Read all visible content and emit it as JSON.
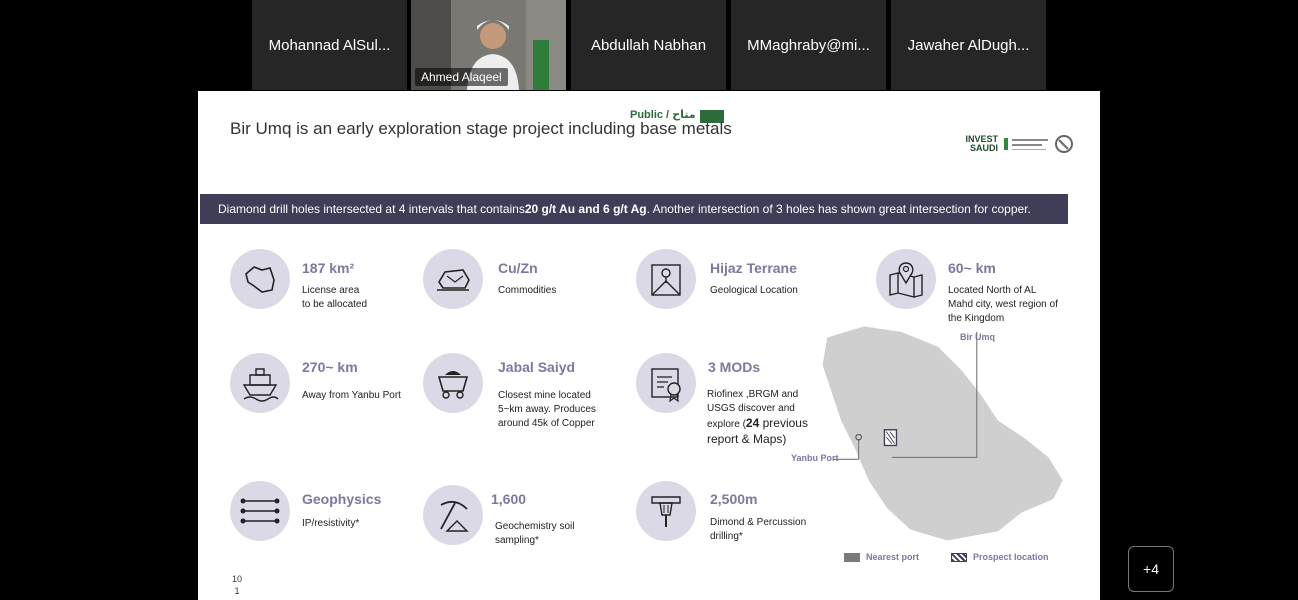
{
  "participants": [
    {
      "name": "Mohannad AlSul..."
    },
    {
      "name": "Ahmed Alaqeel"
    },
    {
      "name": "Abdullah Nabhan"
    },
    {
      "name": "MMaghraby@mi..."
    },
    {
      "name": "Jawaher AlDugh..."
    }
  ],
  "more_participants": "+4",
  "slide": {
    "classification": "Public / متاح",
    "title": "Bir Umq is an early exploration stage project including base metals",
    "logo_text_line1": "INVEST",
    "logo_text_line2": "SAUDI",
    "banner": {
      "pre": "Diamond drill holes intersected at 4 intervals that contains ",
      "bold": "20 g/t Au and 6 g/t Ag",
      "post": ". Another intersection of 3 holes has shown great intersection for copper."
    },
    "items": [
      {
        "icon": "saudi-map-icon",
        "head": "187 km²",
        "desc": "License area\nto be allocated"
      },
      {
        "icon": "ore-rock-icon",
        "head": "Cu/Zn",
        "desc": "Commodities"
      },
      {
        "icon": "map-pin-paper-icon",
        "head": "Hijaz Terrane",
        "desc": "Geological Location"
      },
      {
        "icon": "location-map-icon",
        "head": "60~ km",
        "desc": "Located North of AL Mahd city, west region of the Kingdom"
      },
      {
        "icon": "ship-icon",
        "head": "270~ km",
        "desc": "Away from Yanbu Port"
      },
      {
        "icon": "mine-cart-icon",
        "head": "Jabal Saiyd",
        "desc": "Closest mine located 5~km away. Produces around 45k of Copper"
      },
      {
        "icon": "certificate-icon",
        "head": "3 MODs",
        "desc_pre": "Riofinex ,BRGM and USGS discover and explore (",
        "desc_bold": "24",
        "desc_post": " previous report & Maps)"
      },
      {
        "icon": "geophysics-lines-icon",
        "head": "Geophysics",
        "desc": "IP/resistivity*"
      },
      {
        "icon": "pickaxe-icon",
        "head": "1,600",
        "desc": "Geochemistry soil sampling*"
      },
      {
        "icon": "drill-icon",
        "head": "2,500m",
        "desc": "Dimond & Percussion drilling*"
      }
    ],
    "map_labels": {
      "bir_umq": "Bir Umq",
      "yanbu": "Yanbu Port"
    },
    "legend": [
      {
        "label": "Nearest port",
        "color": "#7a7a7a"
      },
      {
        "label": "Prospect location",
        "color": "#3f3d57"
      }
    ],
    "page_number_line1": "10",
    "page_number_line2": "1"
  },
  "colors": {
    "accent": "#7c78a0",
    "banner": "#3f3d57",
    "icon_bg": "#dcd9e6",
    "public_green": "#2d6b3b"
  }
}
